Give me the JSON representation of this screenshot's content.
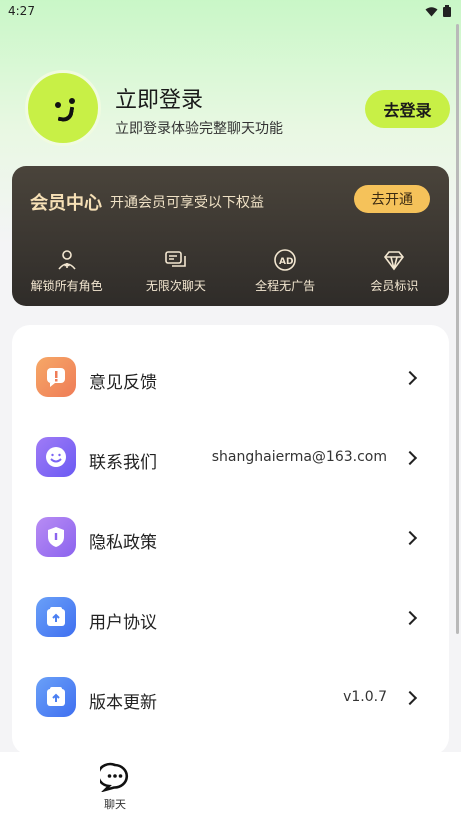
{
  "status": {
    "time": "4:27"
  },
  "profile": {
    "title": "立即登录",
    "subtitle": "立即登录体验完整聊天功能",
    "login_button": "去登录"
  },
  "vip": {
    "title": "会员中心",
    "subtitle": "开通会员可享受以下权益",
    "open_button": "去开通",
    "benefits": [
      {
        "label": "解锁所有角色",
        "icon": "user-add-icon"
      },
      {
        "label": "无限次聊天",
        "icon": "chat-icon"
      },
      {
        "label": "全程无广告",
        "icon": "ad-icon"
      },
      {
        "label": "会员标识",
        "icon": "diamond-icon"
      }
    ]
  },
  "menu": [
    {
      "label": "意见反馈",
      "value": "",
      "icon": "feedback-icon",
      "color": "#f58f4f"
    },
    {
      "label": "联系我们",
      "value": "shanghaierma@163.com",
      "icon": "contact-icon",
      "color": "#8b5cf6"
    },
    {
      "label": "隐私政策",
      "value": "",
      "icon": "privacy-icon",
      "color": "#9e72ef"
    },
    {
      "label": "用户协议",
      "value": "",
      "icon": "agreement-icon",
      "color": "#4f7ff6"
    },
    {
      "label": "版本更新",
      "value": "v1.0.7",
      "icon": "update-icon",
      "color": "#4b84f4"
    }
  ],
  "tabbar": [
    {
      "label": "聊天",
      "icon": "chat-bubble-icon"
    }
  ],
  "colors": {
    "accent": "#c8f046",
    "vip_gold": "#f5c25a",
    "vip_bg": "#3a3530"
  }
}
